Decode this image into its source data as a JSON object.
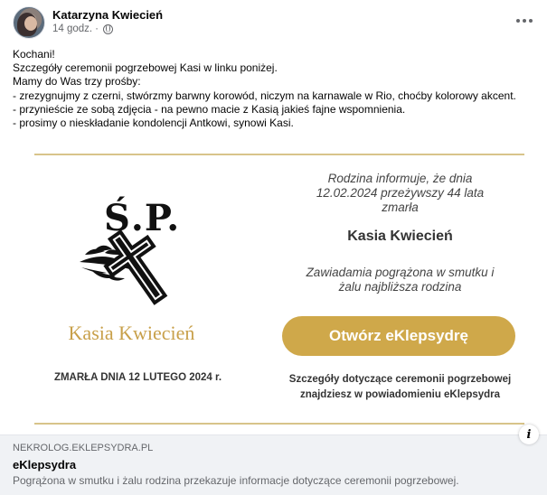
{
  "post": {
    "author": "Katarzyna Kwiecień",
    "time": "14 godz.",
    "separator": "·",
    "icons": {
      "privacy": "globe-icon",
      "menu": "more-options-icon",
      "info": "info-icon"
    },
    "text_lines": [
      "Kochani!",
      "Szczegóły ceremonii pogrzebowej Kasi w linku poniżej.",
      "Mamy do Was trzy prośby:",
      "- zrezygnujmy z czerni, stwórzmy barwny korowód, niczym na karnawale w Rio, choćby kolorowy akcent.",
      "- przynieście ze sobą zdjęcia - na pewno macie z Kasią jakieś fajne wspomnienia.",
      "- prosimy o nieskładanie kondolencji Antkowi, synowi Kasi."
    ]
  },
  "preview": {
    "sp_label": "Ś.P.",
    "name_left": "Kasia Kwiecień",
    "died_left": "ZMARŁA DNIA 12 LUTEGO 2024 r.",
    "info_lines": [
      "Rodzina informuje, że dnia",
      "12.02.2024 przeżywszy 44 lata",
      "zmarła"
    ],
    "name_right": "Kasia Kwiecień",
    "sub_lines": [
      "Zawiadamia pogrążona w smutku i",
      "żalu najbliższa rodzina"
    ],
    "button_label": "Otwórz eKlepsydrę",
    "details_lines": [
      "Szczegóły dotyczące ceremonii pogrzebowej",
      "znajdziesz w powiadomieniu eKlepsydra"
    ],
    "info_glyph": "i",
    "colors": {
      "gold": "#cfa84a",
      "gold_line": "#d8c48a"
    }
  },
  "link": {
    "domain": "NEKROLOG.EKLEPSYDRA.PL",
    "title": "eKlepsydra",
    "description": "Pogrążona w smutku i żalu rodzina przekazuje informacje dotyczące ceremonii pogrzebowej."
  }
}
